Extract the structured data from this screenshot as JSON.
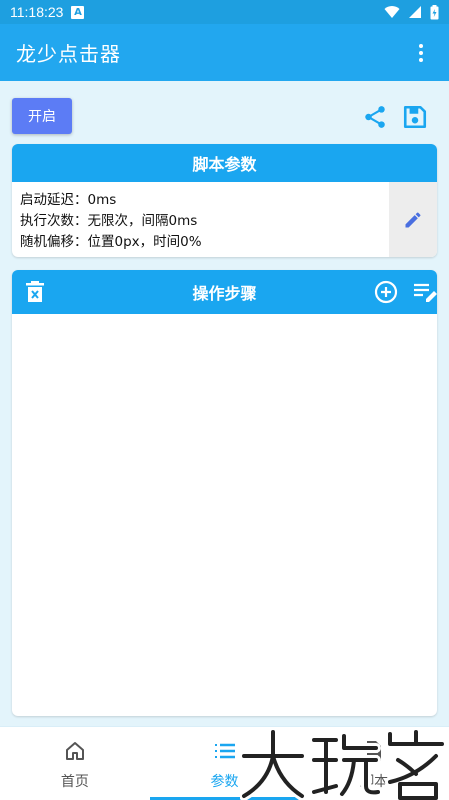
{
  "status_bar": {
    "time": "11:18:23",
    "notification_badge": "A"
  },
  "app_bar": {
    "title": "龙少点击器",
    "more_icon": "more-vert-icon"
  },
  "toolbar": {
    "start_label": "开启",
    "share_icon": "share-icon",
    "save_icon": "save-icon"
  },
  "params": {
    "header": "脚本参数",
    "lines": [
      "启动延迟：0ms",
      "执行次数：无限次，间隔0ms",
      "随机偏移：位置0px，时间0%"
    ],
    "edit_icon": "pencil-icon"
  },
  "steps": {
    "header": "操作步骤"
  },
  "nav": {
    "items": [
      {
        "label": "首页",
        "icon": "home-icon"
      },
      {
        "label": "参数",
        "icon": "list-icon"
      },
      {
        "label": "脚本",
        "icon": "document-icon"
      }
    ],
    "active_index": 1
  },
  "watermark": {
    "text": "大玩家"
  },
  "colors": {
    "primary": "#22a7ef",
    "accent": "#5c7cf5",
    "background": "#e3f4fb"
  }
}
